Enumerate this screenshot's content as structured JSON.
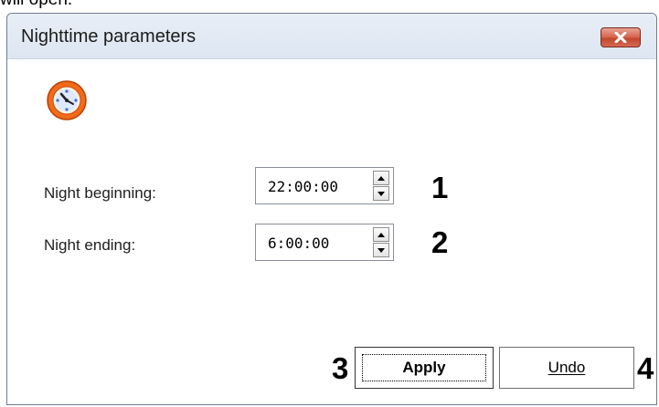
{
  "intro_text": "will open.",
  "window": {
    "title": "Nighttime parameters",
    "icon": "alarm-clock-icon",
    "close_icon": "close-x-icon"
  },
  "fields": [
    {
      "label": "Night beginning:",
      "value": "22:00:00",
      "callout": "1"
    },
    {
      "label": "Night ending:",
      "value": "6:00:00",
      "callout": "2"
    }
  ],
  "buttons": {
    "apply": {
      "label": "Apply",
      "callout": "3"
    },
    "undo": {
      "label": "Undo",
      "callout": "4"
    }
  },
  "colors": {
    "close_button": "#c94a30",
    "title_bar": "#dfe7f2",
    "clock_orange": "#f26a1b"
  }
}
